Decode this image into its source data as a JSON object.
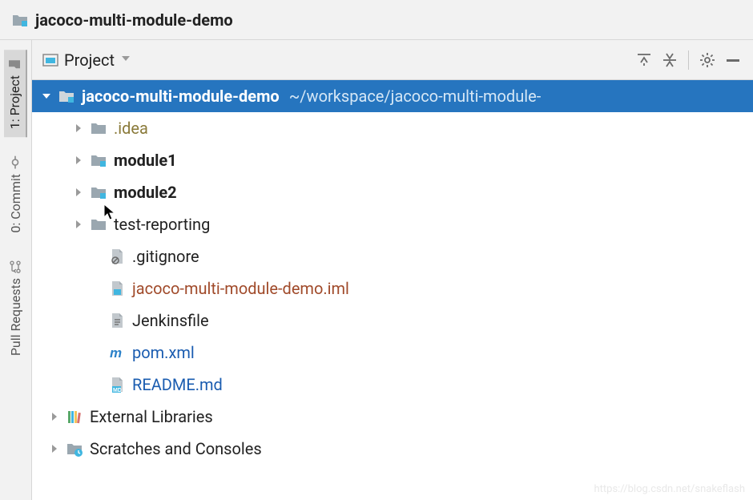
{
  "nav": {
    "title": "jacoco-multi-module-demo"
  },
  "sidebar": {
    "tabs": [
      {
        "label": "1: Project",
        "active": true
      },
      {
        "label": "0: Commit",
        "active": false
      },
      {
        "label": "Pull Requests",
        "active": false
      }
    ]
  },
  "toolbar": {
    "tool_window": "Project"
  },
  "tree": {
    "root": {
      "label": "jacoco-multi-module-demo",
      "path": "~/workspace/jacoco-multi-module-",
      "children": [
        {
          "label": ".idea",
          "icon": "folder",
          "style": "idea",
          "expandable": true
        },
        {
          "label": "module1",
          "icon": "module-folder",
          "style": "bold",
          "expandable": true
        },
        {
          "label": "module2",
          "icon": "module-folder",
          "style": "bold",
          "expandable": true
        },
        {
          "label": "test-reporting",
          "icon": "folder",
          "style": "",
          "expandable": true
        },
        {
          "label": ".gitignore",
          "icon": "file-ignore",
          "style": "",
          "expandable": false
        },
        {
          "label": "jacoco-multi-module-demo.iml",
          "icon": "file-iml",
          "style": "iml",
          "expandable": false
        },
        {
          "label": "Jenkinsfile",
          "icon": "file-text",
          "style": "",
          "expandable": false
        },
        {
          "label": "pom.xml",
          "icon": "file-maven",
          "style": "link",
          "expandable": false
        },
        {
          "label": "README.md",
          "icon": "file-md",
          "style": "link",
          "expandable": false
        }
      ]
    },
    "external": {
      "label": "External Libraries"
    },
    "scratches": {
      "label": "Scratches and Consoles"
    }
  },
  "watermark": "https://blog.csdn.net/snakeflash"
}
